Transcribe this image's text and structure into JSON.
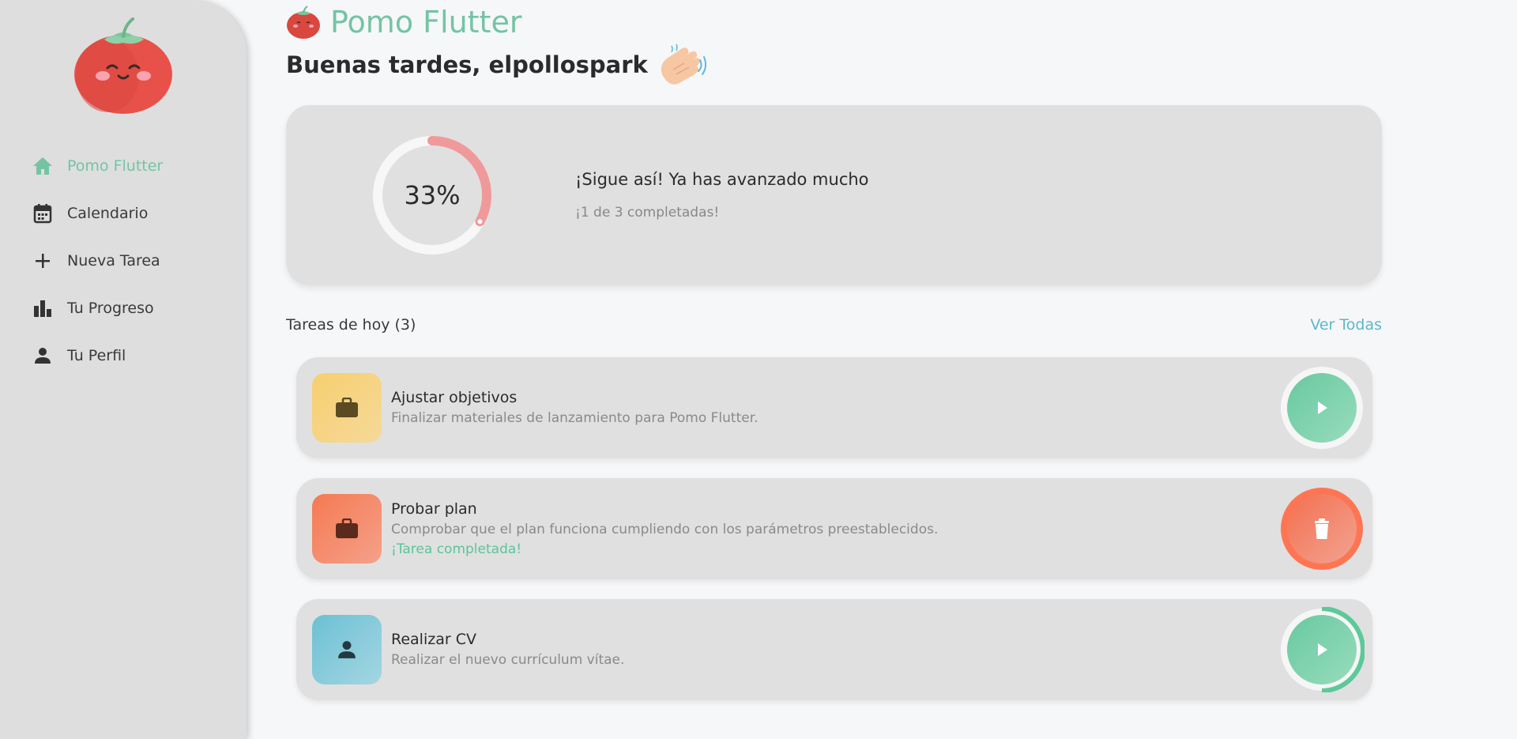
{
  "sidebar": {
    "items": [
      {
        "label": "Pomo Flutter",
        "icon": "home-icon",
        "active": true
      },
      {
        "label": "Calendario",
        "icon": "calendar-icon",
        "active": false
      },
      {
        "label": "Nueva Tarea",
        "icon": "plus-icon",
        "active": false
      },
      {
        "label": "Tu Progreso",
        "icon": "bar-chart-icon",
        "active": false
      },
      {
        "label": "Tu Perfil",
        "icon": "person-icon",
        "active": false
      }
    ]
  },
  "header": {
    "title": "Pomo Flutter",
    "greeting": "Buenas tardes, elpollospark"
  },
  "progress": {
    "percent_label": "33%",
    "fraction": 0.33,
    "title": "¡Sigue así! Ya has avanzado mucho",
    "subtitle": "¡1 de 3 completadas!"
  },
  "tasks_section": {
    "heading": "Tareas de hoy (3)",
    "see_all": "Ver Todas"
  },
  "tasks": [
    {
      "title": "Ajustar objetivos",
      "description": "Finalizar materiales de lanzamiento para Pomo Flutter.",
      "status": "",
      "icon": "briefcase-icon",
      "action": "play-icon",
      "color": "#f7cf79"
    },
    {
      "title": "Probar plan",
      "description": "Comprobar que el plan funciona cumpliendo con los parámetros preestablecidos.",
      "status": "¡Tarea completada!",
      "icon": "briefcase-icon",
      "action": "trash-icon",
      "color": "#f57e5c"
    },
    {
      "title": "Realizar CV",
      "description": "Realizar el nuevo currículum vítae.",
      "status": "",
      "icon": "person-icon",
      "action": "play-icon",
      "color": "#74c3d6"
    }
  ],
  "colors": {
    "accent": "#74c4a4",
    "link": "#5ab8cc",
    "ring": "#f0999b",
    "danger": "#ff7553"
  }
}
